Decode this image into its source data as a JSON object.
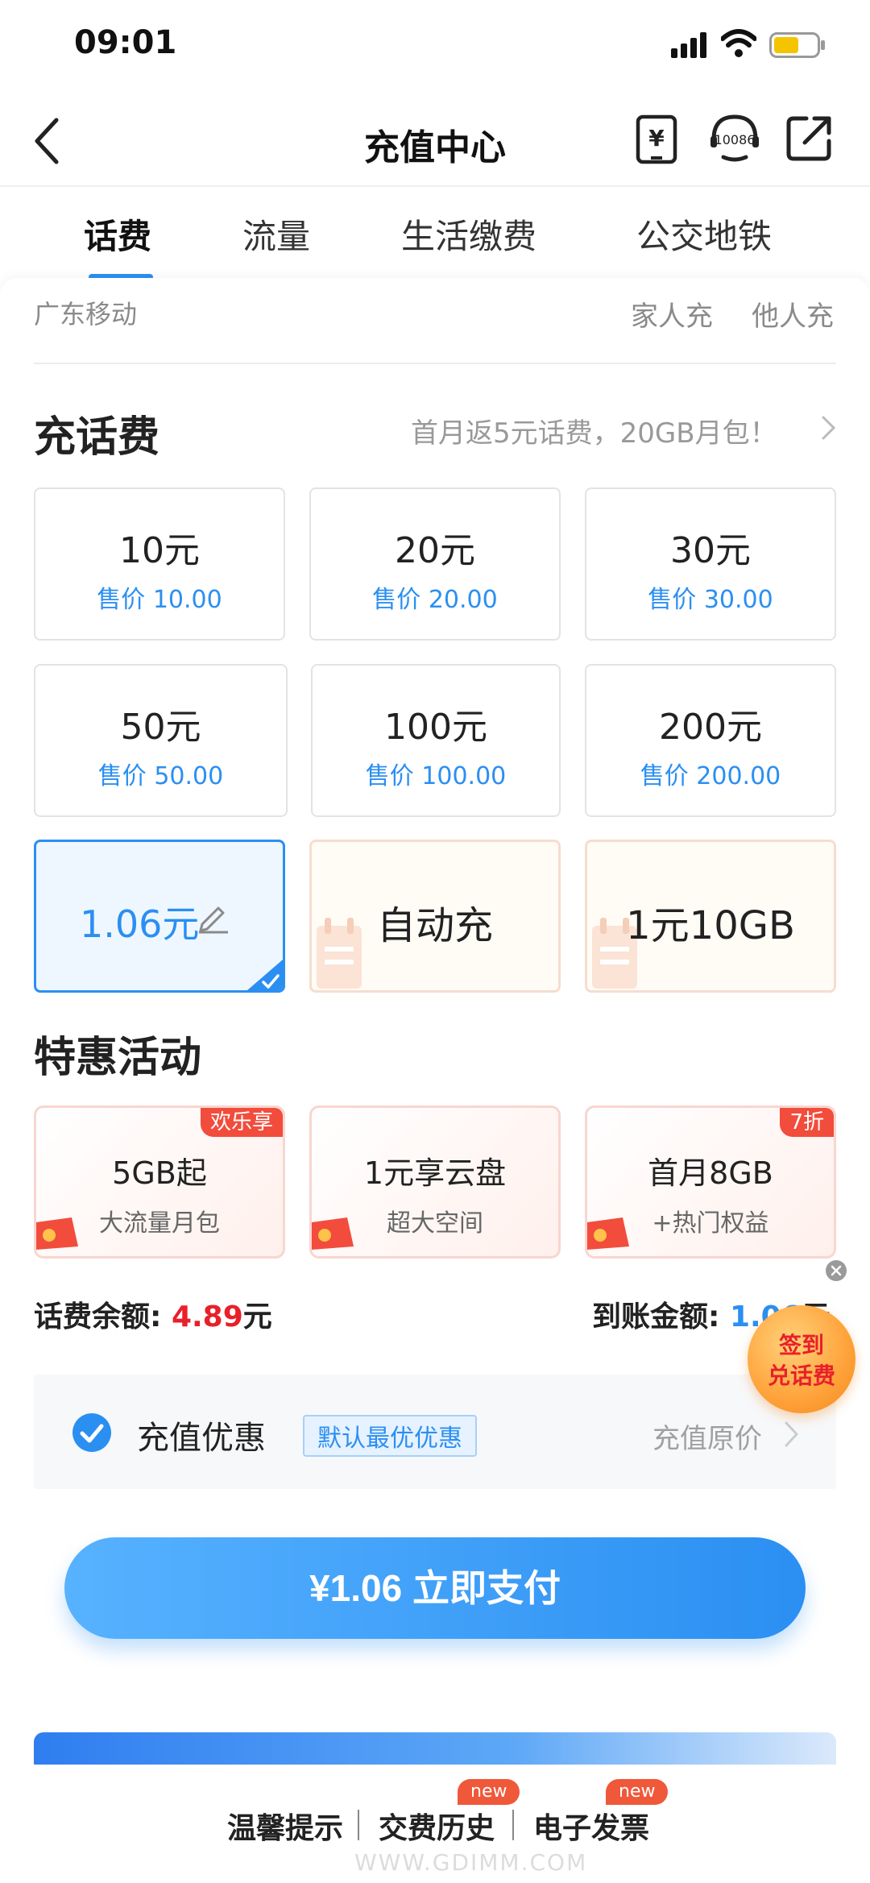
{
  "status_bar": {
    "time": "09:01"
  },
  "header": {
    "title": "充值中心",
    "hotline_number": "10086",
    "recharge_icon_glyph": "¥"
  },
  "tabs": [
    {
      "label": "话费",
      "active": true
    },
    {
      "label": "流量",
      "active": false
    },
    {
      "label": "生活缴费",
      "active": false
    },
    {
      "label": "公交地铁",
      "active": false
    }
  ],
  "carrier": "广东移动",
  "recharge_modes": {
    "family": "家人充",
    "others": "他人充"
  },
  "topup": {
    "title": "充话费",
    "promo": "首月返5元话费，20GB月包！",
    "amounts": [
      {
        "label": "10元",
        "price": "售价 10.00"
      },
      {
        "label": "20元",
        "price": "售价 20.00"
      },
      {
        "label": "30元",
        "price": "售价 30.00"
      },
      {
        "label": "50元",
        "price": "售价 50.00"
      },
      {
        "label": "100元",
        "price": "售价 100.00"
      },
      {
        "label": "200元",
        "price": "售价 200.00"
      }
    ],
    "custom_amount": "1.06元",
    "custom_selected": true,
    "features": [
      {
        "label": "自动充"
      },
      {
        "label": "1元10GB"
      }
    ]
  },
  "offers": {
    "title": "特惠活动",
    "items": [
      {
        "title": "5GB起",
        "subtitle": "大流量月包",
        "badge": "欢乐享"
      },
      {
        "title": "1元享云盘",
        "subtitle": "超大空间",
        "badge": ""
      },
      {
        "title": "首月8GB",
        "subtitle": "+热门权益",
        "badge": "7折"
      }
    ]
  },
  "balance": {
    "label": "话费余额: ",
    "value": "4.89",
    "unit": "元"
  },
  "arrival": {
    "label": "到账金额: ",
    "value": "1.06",
    "unit": "元"
  },
  "signin": {
    "line1": "签到",
    "line2": "兑话费"
  },
  "discount": {
    "label": "充值优惠",
    "tag": "默认最优优惠",
    "original": "充值原价",
    "checked": true
  },
  "pay_button": {
    "label": "¥1.06  立即支付"
  },
  "footer": {
    "links": [
      {
        "label": "温馨提示",
        "badge": ""
      },
      {
        "label": "交费历史",
        "badge": "new"
      },
      {
        "label": "电子发票",
        "badge": "new"
      }
    ]
  },
  "watermark": "WWW.GDIMM.COM",
  "colors": {
    "accent": "#2b8ff2",
    "danger": "#e8202a",
    "badge": "#f24c3c"
  }
}
